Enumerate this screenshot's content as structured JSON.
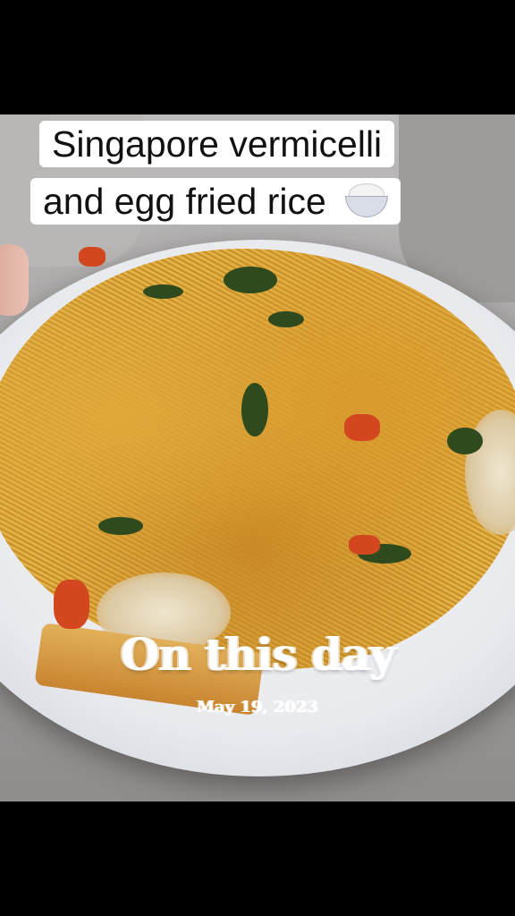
{
  "caption": {
    "line1": "Singapore vermicelli",
    "line2": "and egg fried rice",
    "icon": "rice-bowl-icon"
  },
  "memory": {
    "title": "On this day",
    "date": "May 19, 2023"
  }
}
